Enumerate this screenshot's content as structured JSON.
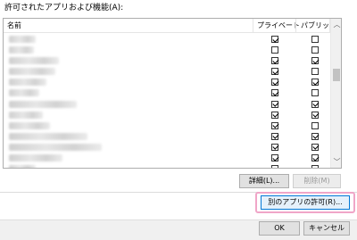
{
  "apps_label": "許可されたアプリおよび機能(A):",
  "table": {
    "headers": {
      "name": "名前",
      "private": "プライベート",
      "public": "パブリック"
    },
    "rows": [
      {
        "name": "",
        "private": true,
        "public": false
      },
      {
        "name": "",
        "private": false,
        "public": false
      },
      {
        "name": "",
        "private": true,
        "public": true
      },
      {
        "name": "",
        "private": true,
        "public": false
      },
      {
        "name": "",
        "private": true,
        "public": true
      },
      {
        "name": "",
        "private": true,
        "public": false
      },
      {
        "name": "",
        "private": true,
        "public": true
      },
      {
        "name": "",
        "private": true,
        "public": true
      },
      {
        "name": "",
        "private": true,
        "public": false
      },
      {
        "name": "",
        "private": true,
        "public": true
      },
      {
        "name": "",
        "private": true,
        "public": true
      },
      {
        "name": "",
        "private": true,
        "public": true
      },
      {
        "name": "",
        "private": true,
        "public": true
      }
    ]
  },
  "scroll": {
    "up_glyph": "︿",
    "down_glyph": "﹀"
  },
  "buttons": {
    "details": "詳細(L)...",
    "remove": "削除(M)",
    "allow_another": "別のアプリの許可(R)...",
    "ok": "OK",
    "cancel": "キャンセル"
  },
  "colors": {
    "highlight": "#f0a6c8",
    "focus": "#0078d7"
  }
}
